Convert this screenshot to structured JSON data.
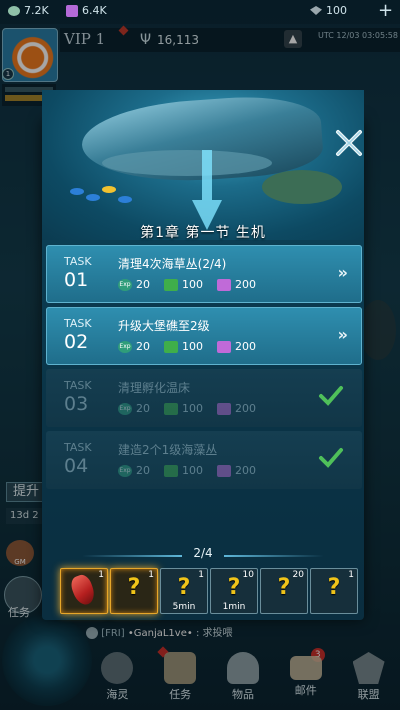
{
  "resources": {
    "res1_value": "7.2K",
    "res2_value": "6.4K",
    "res3_value": "100"
  },
  "header": {
    "vip_label": "VIP 1",
    "power_value": "16,113",
    "utc_time": "UTC 12/03 03:05:58"
  },
  "side": {
    "upgrade_label": "提升",
    "days_label": "13d 2",
    "gm_label": "GM",
    "task_label": "任务"
  },
  "modal": {
    "chapter_title": "第1章 第一节 生机",
    "tasks": [
      {
        "label": "TASK",
        "number": "01",
        "title": "清理4次海草丛(2/4)",
        "exp": "20",
        "resource_green": "100",
        "resource_purple": "200",
        "state": "active"
      },
      {
        "label": "TASK",
        "number": "02",
        "title": "升级大堡礁至2级",
        "exp": "20",
        "resource_green": "100",
        "resource_purple": "200",
        "state": "active"
      },
      {
        "label": "TASK",
        "number": "03",
        "title": "清理孵化温床",
        "exp": "20",
        "resource_green": "100",
        "resource_purple": "200",
        "state": "done"
      },
      {
        "label": "TASK",
        "number": "04",
        "title": "建造2个1级海藻丛",
        "exp": "20",
        "resource_green": "100",
        "resource_purple": "200",
        "state": "done"
      }
    ],
    "exp_icon_text": "Exp",
    "go_symbol": "»",
    "pager": "2/4",
    "rewards": [
      {
        "count": "1",
        "time": ""
      },
      {
        "count": "1",
        "time": ""
      },
      {
        "count": "1",
        "time": "5min"
      },
      {
        "count": "10",
        "time": "1min"
      },
      {
        "count": "20",
        "time": ""
      },
      {
        "count": "1",
        "time": ""
      }
    ],
    "question_mark": "?"
  },
  "chat": {
    "channel": "[FRI]",
    "name": "•GanjaL1ve•",
    "message": ": 求投喂"
  },
  "nav": {
    "items": [
      "海灵",
      "任务",
      "物品",
      "邮件",
      "联盟"
    ],
    "mail_badge": "3"
  },
  "colors": {
    "modal_bg": "#0b3b50",
    "active_task": "#2f8fb0",
    "done_task": "#153e51",
    "reward_glow": "#e7a72a",
    "question_mark": "#f0c419"
  }
}
